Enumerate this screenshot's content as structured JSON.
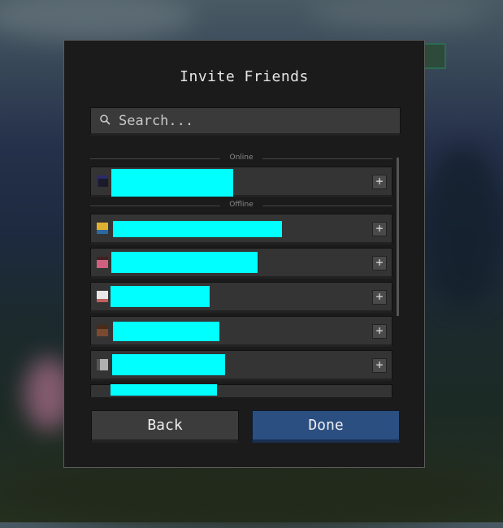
{
  "dialog": {
    "title": "Invite Friends",
    "search_placeholder": "Search...",
    "sections": {
      "online_label": "Online",
      "offline_label": "Offline"
    },
    "buttons": {
      "back": "Back",
      "done": "Done"
    },
    "plus_symbol": "+"
  },
  "colors": {
    "redaction": "#00ffff",
    "done_button": "#2c4f82",
    "dialog_bg": "#1b1b1b"
  },
  "icons": [
    "search-icon",
    "plus-icon",
    "player-head-icon"
  ]
}
